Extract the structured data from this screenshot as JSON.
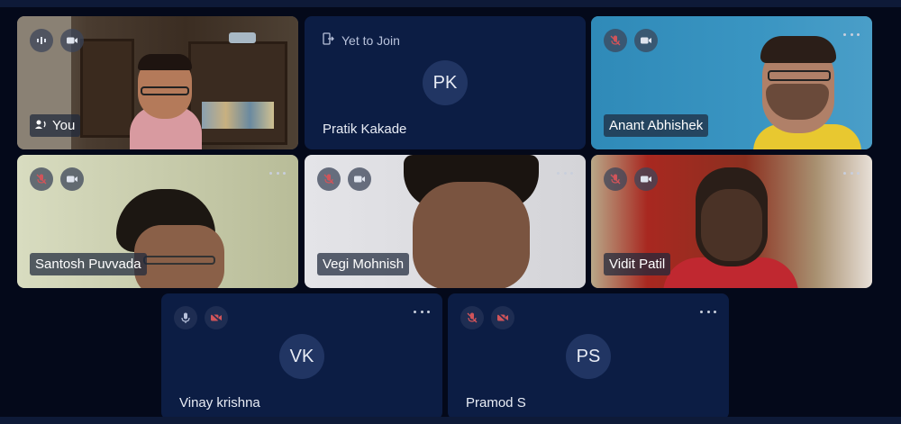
{
  "tiles": [
    {
      "name": "You",
      "initials": "",
      "status": ""
    },
    {
      "name": "Pratik Kakade",
      "initials": "PK",
      "status": "Yet to Join"
    },
    {
      "name": "Anant Abhishek",
      "initials": "",
      "status": ""
    },
    {
      "name": "Santosh Puvvada",
      "initials": "",
      "status": ""
    },
    {
      "name": "Vegi Mohnish",
      "initials": "",
      "status": ""
    },
    {
      "name": "Vidit Patil",
      "initials": "",
      "status": ""
    },
    {
      "name": "Vinay krishna",
      "initials": "VK",
      "status": ""
    },
    {
      "name": "Pramod S",
      "initials": "PS",
      "status": ""
    }
  ],
  "icons": {
    "mic_on": "mic-icon",
    "mic_off": "mic-off-icon",
    "cam_on": "camera-icon",
    "cam_off": "camera-off-icon",
    "speaking": "speaking-icon",
    "more": "more-options-icon",
    "join": "join-door-icon"
  },
  "colors": {
    "muted_red": "#d0545a",
    "tile_bg": "#0c1d44",
    "page_bg": "#04091a"
  }
}
